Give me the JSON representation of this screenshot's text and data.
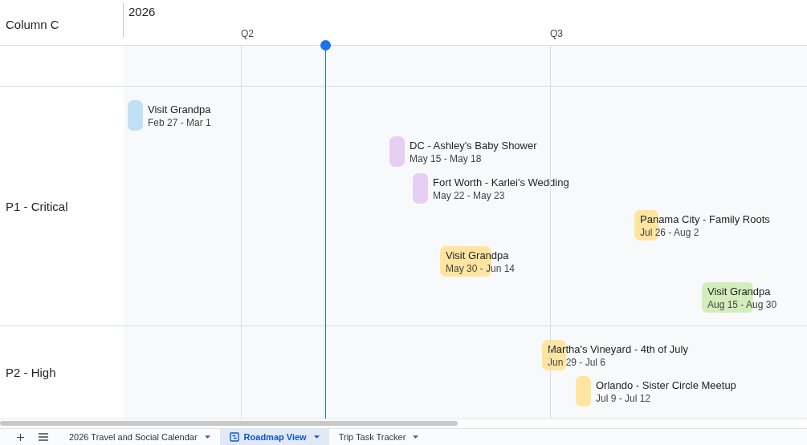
{
  "header": {
    "column_label": "Column C",
    "year": "2026",
    "quarters": [
      {
        "label": "Q2"
      },
      {
        "label": "Q3"
      }
    ]
  },
  "groups": [
    {
      "label": "P1 - Critical",
      "events": [
        {
          "title": "Visit Grandpa",
          "dates": "Feb 27 - Mar 1",
          "color": "#bfe1f6"
        },
        {
          "title": "DC - Ashley's Baby Shower",
          "dates": "May 15 - May 18",
          "color": "#e6cff2"
        },
        {
          "title": "Fort Worth - Karlei's Wedding",
          "dates": "May 22 - May 23",
          "color": "#e6cff2"
        },
        {
          "title": "Panama City - Family Roots",
          "dates": "Jul 26 - Aug 2",
          "color": "#ffe5a0"
        },
        {
          "title": "Visit Grandpa",
          "dates": "May 30 - Jun 14",
          "color": "#ffe5a0"
        },
        {
          "title": "Visit Grandpa",
          "dates": "Aug 15 - Aug 30",
          "color": "#d4edbc"
        }
      ]
    },
    {
      "label": "P2 - High",
      "events": [
        {
          "title": "Martha's Vineyard - 4th of July",
          "dates": "Jun 29 - Jul 6",
          "color": "#ffe5a0"
        },
        {
          "title": "Orlando - Sister Circle Meetup",
          "dates": "Jul 9 - Jul 12",
          "color": "#ffe5a0"
        }
      ]
    }
  ],
  "sheet_tabs": [
    {
      "label": "2026 Travel and Social Calendar",
      "selected": false
    },
    {
      "label": "Roadmap View",
      "selected": true
    },
    {
      "label": "Trip Task Tracker",
      "selected": false
    }
  ]
}
